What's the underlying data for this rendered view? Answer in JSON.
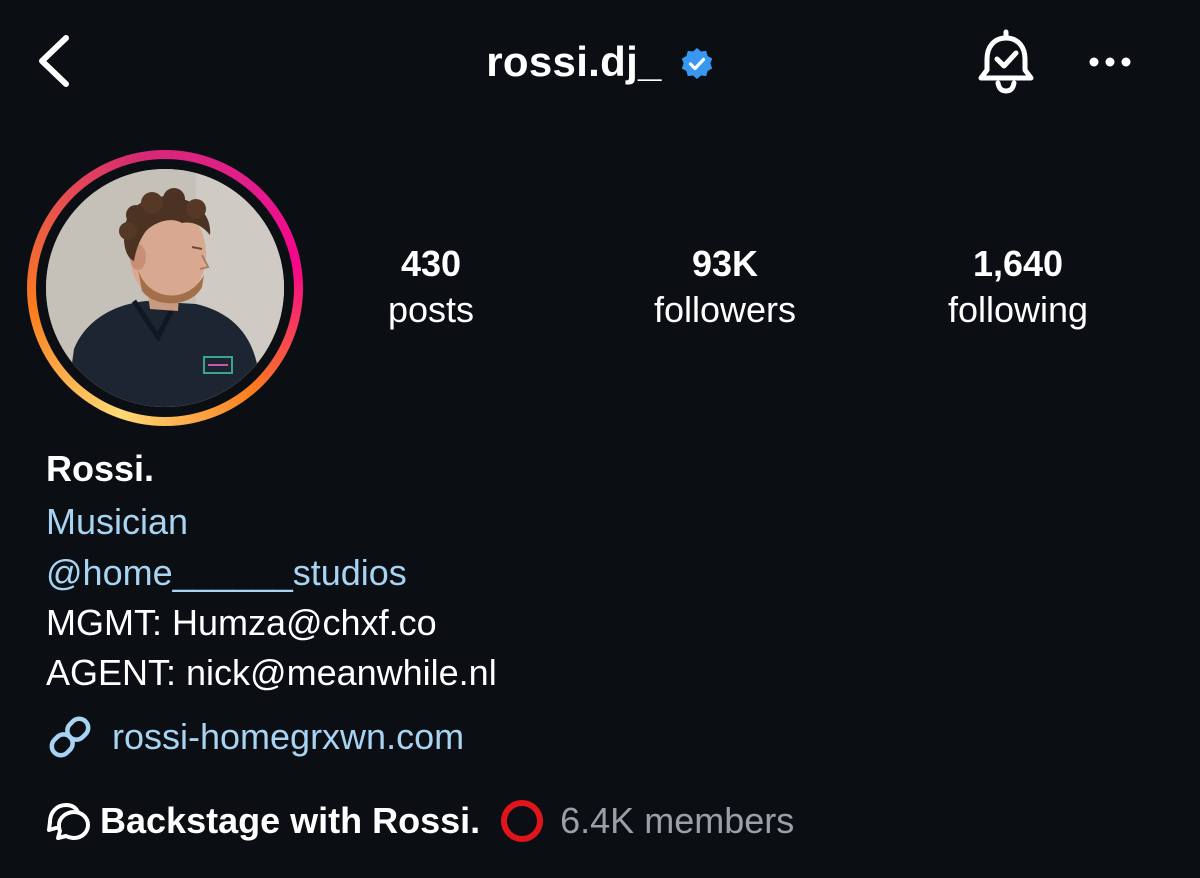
{
  "header": {
    "username": "rossi.dj_",
    "verified": true,
    "icons": [
      "back-chevron-icon",
      "verified-badge-icon",
      "bell-check-icon",
      "more-options-icon"
    ]
  },
  "stats": {
    "posts": {
      "value": "430",
      "label": "posts"
    },
    "followers": {
      "value": "93K",
      "label": "followers"
    },
    "following": {
      "value": "1,640",
      "label": "following"
    }
  },
  "bio": {
    "name": "Rossi.",
    "category": "Musician",
    "mention": "@home______studios",
    "mgmt": "MGMT: Humza@chxf.co",
    "agent": "AGENT: nick@meanwhile.nl",
    "link": "rossi-homegrxwn.com"
  },
  "channel": {
    "name": "Backstage with Rossi.",
    "members": "6.4K members"
  },
  "colors": {
    "background": "#0b0f14",
    "text": "#ffffff",
    "link": "#a8d4f3",
    "verified": "#3897f0",
    "muted": "#9aa0a6",
    "channel_ring": "#e0151b"
  }
}
